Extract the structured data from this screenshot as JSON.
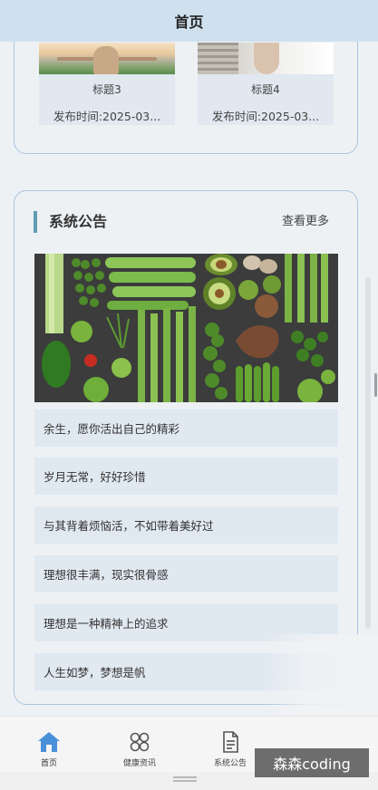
{
  "nav": {
    "title": "首页"
  },
  "articles": [
    {
      "title": "标题3",
      "time": "发布时间:2025-03..."
    },
    {
      "title": "标题4",
      "time": "发布时间:2025-03..."
    }
  ],
  "notice": {
    "title": "系统公告",
    "more": "查看更多",
    "items": [
      "余生，愿你活出自己的精彩",
      "岁月无常，好好珍惜",
      "与其背着烦恼活，不如带着美好过",
      "理想很丰满，现实很骨感",
      "理想是一种精神上的追求",
      "人生如梦，梦想是帆"
    ]
  },
  "tabs": [
    {
      "label": "首页",
      "icon": "home-icon",
      "active": true
    },
    {
      "label": "健康资讯",
      "icon": "grid-icon",
      "active": false
    },
    {
      "label": "系统公告",
      "icon": "document-icon",
      "active": false
    }
  ],
  "watermark": "森森coding",
  "colors": {
    "nav_bg": "#cfe1ef",
    "accent": "#5f9db3",
    "home_icon": "#4a90d9",
    "card_border": "#a9c4dd"
  }
}
